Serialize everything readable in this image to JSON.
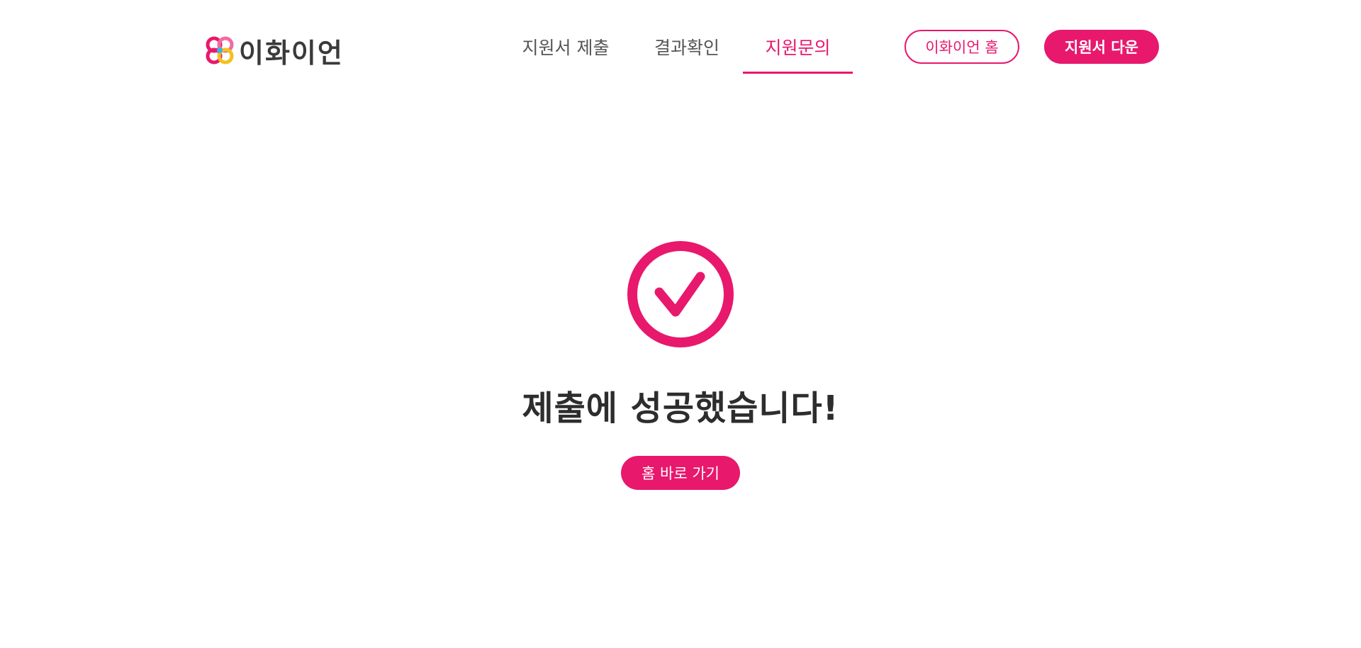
{
  "brand": {
    "logo_text": "이화이언",
    "logo_icon": "flower-logo-icon",
    "accent_color": "#e8186d"
  },
  "nav": {
    "items": [
      {
        "label": "지원서 제출",
        "active": false
      },
      {
        "label": "결과확인",
        "active": false
      },
      {
        "label": "지원문의",
        "active": true
      }
    ]
  },
  "header_buttons": {
    "home_label": "이화이언 홈",
    "download_label": "지원서 다운"
  },
  "main": {
    "status_icon": "check-circle-icon",
    "title": "제출에 성공했습니다!",
    "home_button_label": "홈 바로 가기"
  }
}
